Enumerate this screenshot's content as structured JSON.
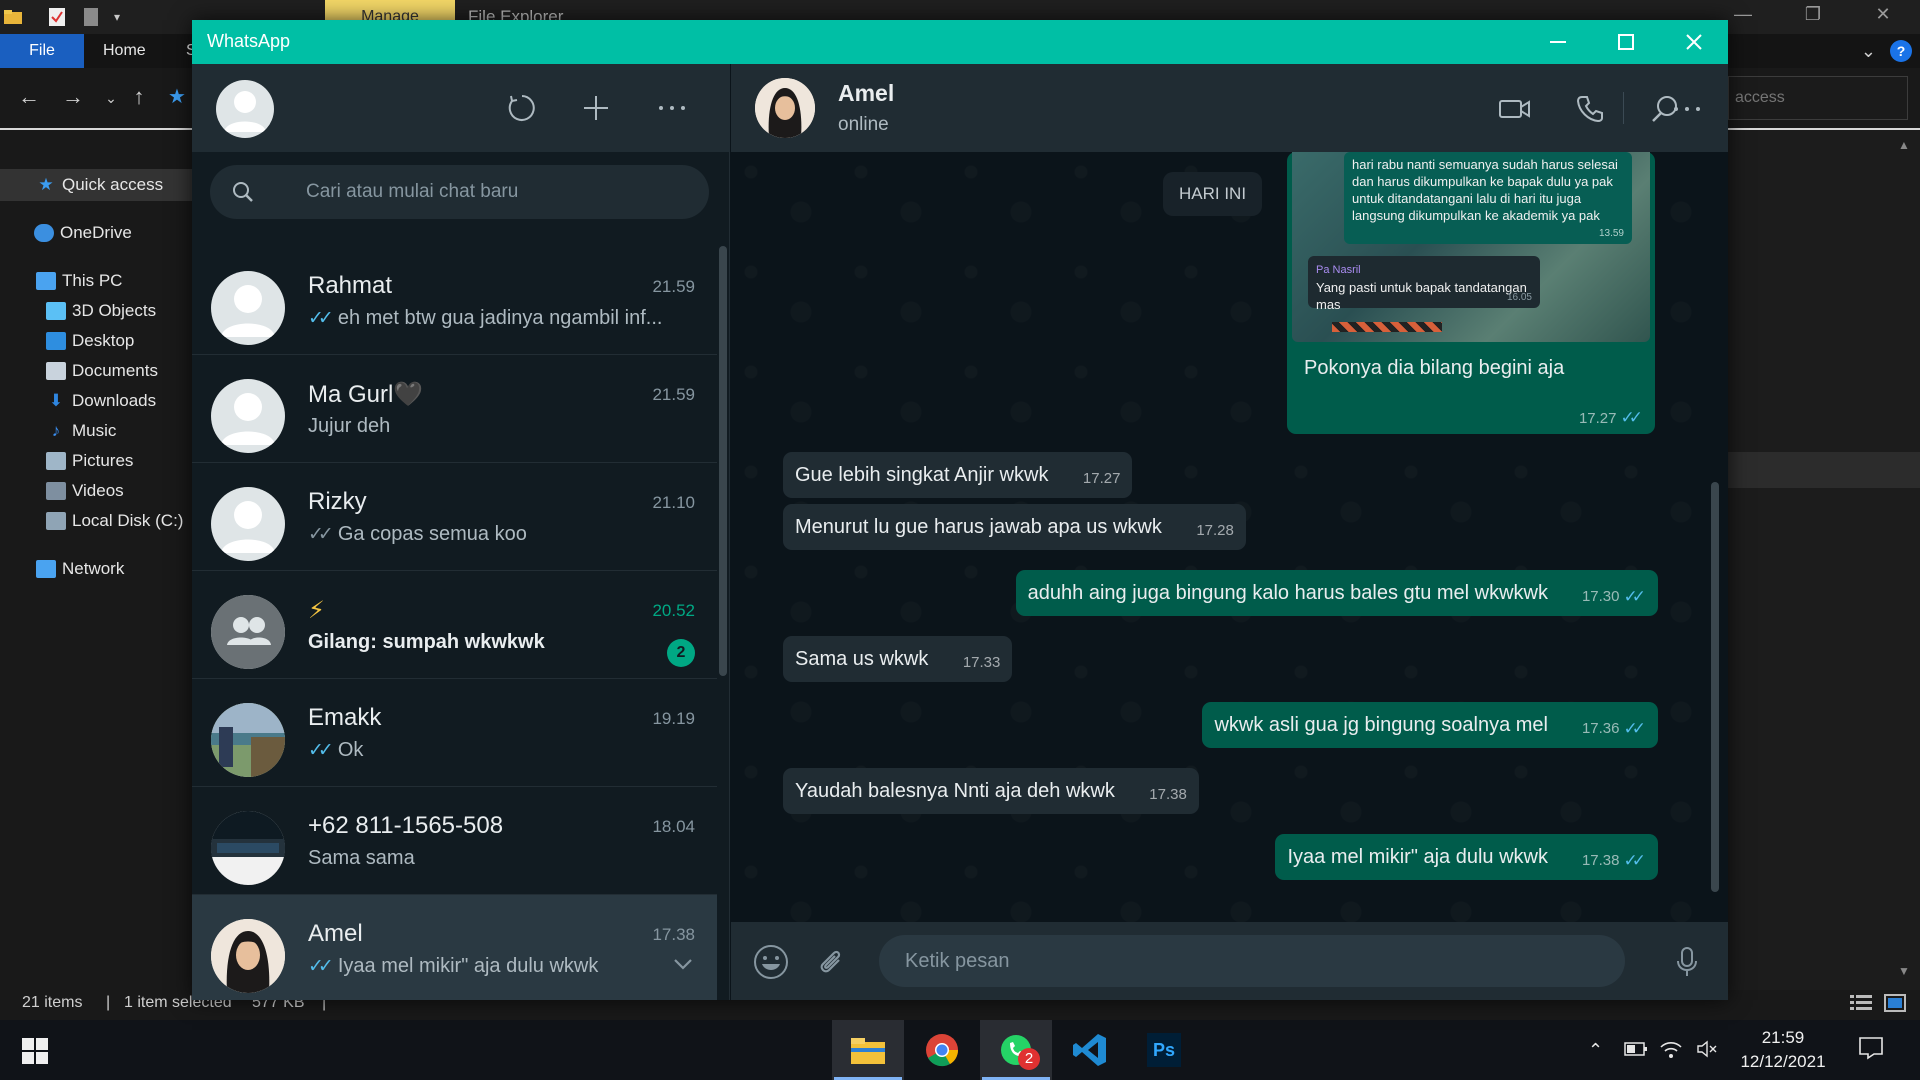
{
  "explorer": {
    "title": "File Explorer",
    "manage_tab": "Manage",
    "file_tab": "File",
    "home_tab": "Home",
    "share_tab_partial": "S",
    "search_placeholder": "access",
    "nav": [
      {
        "label": "Quick access",
        "icon": "star-icon",
        "color": "#3b9cf0"
      },
      {
        "label": "OneDrive",
        "icon": "cloud-icon",
        "color": "#3b8fe0"
      },
      {
        "label": "This PC",
        "icon": "computer-icon",
        "color": "#4aa3f0"
      },
      {
        "label": "3D Objects",
        "icon": "cube-icon",
        "color": "#5bc0f5"
      },
      {
        "label": "Desktop",
        "icon": "desktop-icon",
        "color": "#2e8ee0"
      },
      {
        "label": "Documents",
        "icon": "document-icon",
        "color": "#c9d3dd"
      },
      {
        "label": "Downloads",
        "icon": "download-icon",
        "color": "#2f86e0"
      },
      {
        "label": "Music",
        "icon": "music-icon",
        "color": "#3a8ef0"
      },
      {
        "label": "Pictures",
        "icon": "pictures-icon",
        "color": "#9fb6c8"
      },
      {
        "label": "Videos",
        "icon": "videos-icon",
        "color": "#7e8fa0"
      },
      {
        "label": "Local Disk (C:)",
        "icon": "disk-icon",
        "color": "#8fa4b5"
      },
      {
        "label": "Network",
        "icon": "network-icon",
        "color": "#4aa3f0"
      }
    ],
    "status": {
      "items": "21 items",
      "selected": "1 item selected",
      "size": "577 KB"
    }
  },
  "taskbar": {
    "time": "21:59",
    "date": "12/12/2021",
    "whatsapp_badge": "2",
    "apps": [
      {
        "name": "file-explorer",
        "active": true
      },
      {
        "name": "chrome",
        "active": false
      },
      {
        "name": "whatsapp",
        "active": true
      },
      {
        "name": "vscode",
        "active": false
      },
      {
        "name": "photoshop",
        "active": false,
        "label": "Ps"
      }
    ]
  },
  "whatsapp": {
    "window_title": "WhatsApp",
    "search_placeholder": "Cari atau mulai chat baru",
    "chats": [
      {
        "name": "Rahmat",
        "time": "21.59",
        "preview": "eh met btw gua jadinya ngambil inf...",
        "tick": "read",
        "avatar": "default"
      },
      {
        "name": "Ma Gurl🖤",
        "time": "21.59",
        "preview": "Jujur deh",
        "tick": "none",
        "avatar": "default"
      },
      {
        "name": "Rizky",
        "time": "21.10",
        "preview": "Ga copas semua koo",
        "tick": "delivered",
        "avatar": "default"
      },
      {
        "name": "⚡",
        "time": "20.52",
        "preview": "Gilang: sumpah wkwkwk",
        "tick": "none",
        "avatar": "group",
        "unread": "2"
      },
      {
        "name": "Emakk",
        "time": "19.19",
        "preview": "Ok",
        "tick": "read",
        "avatar": "photo-outdoor"
      },
      {
        "name": "+62 811-1565-508",
        "time": "18.04",
        "preview": "Sama sama",
        "tick": "none",
        "avatar": "photo-gamer"
      },
      {
        "name": "Amel",
        "time": "17.38",
        "preview": "Iyaa mel mikir\" aja dulu wkwk",
        "tick": "read",
        "avatar": "photo-amel"
      }
    ],
    "conversation": {
      "contact_name": "Amel",
      "contact_status": "online",
      "date_chip": "HARI INI",
      "image_message": {
        "embedded_text": "hari rabu nanti semuanya sudah harus selesai dan harus dikumpulkan ke bapak dulu ya pak untuk ditandatangani lalu di hari itu juga langsung dikumpulkan ke akademik ya pak",
        "embedded_time": "13.59",
        "quote_sender": "Pa Nasril",
        "quote_text": "Yang pasti untuk bapak tandatangan mas",
        "quote_time": "16.05",
        "caption": "Pokonya dia bilang begini aja",
        "time": "17.27"
      },
      "messages": [
        {
          "dir": "in",
          "text": "Gue lebih singkat Anjir wkwk",
          "time": "17.27"
        },
        {
          "dir": "in",
          "text": "Menurut lu gue harus jawab apa us wkwk",
          "time": "17.28"
        },
        {
          "dir": "out",
          "text": "aduhh aing juga bingung kalo harus bales gtu mel wkwkwk",
          "time": "17.30"
        },
        {
          "dir": "in",
          "text": "Sama us wkwk",
          "time": "17.33"
        },
        {
          "dir": "out",
          "text": "wkwk asli gua jg bingung soalnya mel",
          "time": "17.36"
        },
        {
          "dir": "in",
          "text": "Yaudah balesnya Nnti aja deh wkwk",
          "time": "17.38"
        },
        {
          "dir": "out",
          "text": "Iyaa mel mikir\" aja dulu wkwk",
          "time": "17.38"
        }
      ],
      "input_placeholder": "Ketik pesan"
    },
    "colors": {
      "accent": "#00bfa5",
      "outgoing_bubble": "#005c4b",
      "incoming_bubble": "#202c33",
      "read_tick": "#53bdeb"
    }
  }
}
